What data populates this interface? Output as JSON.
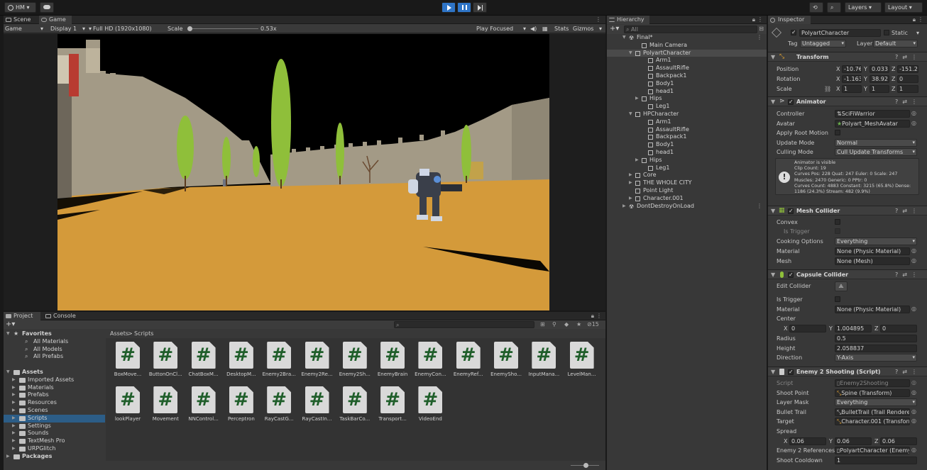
{
  "toolbar": {
    "account_label": "HM",
    "layers_label": "Layers",
    "layout_label": "Layout"
  },
  "game": {
    "tab_scene": "Scene",
    "tab_game": "Game",
    "mode": "Game",
    "display": "Display 1",
    "resolution": "Full HD (1920x1080)",
    "scale_label": "Scale",
    "scale_value": "0.53x",
    "play_focused": "Play Focused",
    "stats": "Stats",
    "gizmos": "Gizmos"
  },
  "hierarchy": {
    "tab": "Hierarchy",
    "search_placeholder": "All",
    "rows": [
      {
        "label": "Final*",
        "indent": 0,
        "arrow": "▼",
        "kind": "scene"
      },
      {
        "label": "Main Camera",
        "indent": 2,
        "arrow": "",
        "kind": "obj"
      },
      {
        "label": "PolyartCharacter",
        "indent": 1,
        "arrow": "▼",
        "kind": "obj",
        "sel": true
      },
      {
        "label": "Arm1",
        "indent": 3,
        "arrow": "",
        "kind": "obj"
      },
      {
        "label": "AssaultRifle",
        "indent": 3,
        "arrow": "",
        "kind": "obj"
      },
      {
        "label": "Backpack1",
        "indent": 3,
        "arrow": "",
        "kind": "obj"
      },
      {
        "label": "Body1",
        "indent": 3,
        "arrow": "",
        "kind": "obj"
      },
      {
        "label": "head1",
        "indent": 3,
        "arrow": "",
        "kind": "obj"
      },
      {
        "label": "Hips",
        "indent": 2,
        "arrow": "▶",
        "kind": "obj"
      },
      {
        "label": "Leg1",
        "indent": 3,
        "arrow": "",
        "kind": "obj"
      },
      {
        "label": "HPCharacter",
        "indent": 1,
        "arrow": "▼",
        "kind": "obj"
      },
      {
        "label": "Arm1",
        "indent": 3,
        "arrow": "",
        "kind": "obj"
      },
      {
        "label": "AssaultRifle",
        "indent": 3,
        "arrow": "",
        "kind": "obj"
      },
      {
        "label": "Backpack1",
        "indent": 3,
        "arrow": "",
        "kind": "obj"
      },
      {
        "label": "Body1",
        "indent": 3,
        "arrow": "",
        "kind": "obj"
      },
      {
        "label": "head1",
        "indent": 3,
        "arrow": "",
        "kind": "obj"
      },
      {
        "label": "Hips",
        "indent": 2,
        "arrow": "▶",
        "kind": "obj"
      },
      {
        "label": "Leg1",
        "indent": 3,
        "arrow": "",
        "kind": "obj"
      },
      {
        "label": "Core",
        "indent": 1,
        "arrow": "▶",
        "kind": "obj"
      },
      {
        "label": "THE WHOLE CITY",
        "indent": 1,
        "arrow": "▶",
        "kind": "obj"
      },
      {
        "label": "Point Light",
        "indent": 1,
        "arrow": "",
        "kind": "obj"
      },
      {
        "label": "Character.001",
        "indent": 1,
        "arrow": "▶",
        "kind": "obj"
      },
      {
        "label": "DontDestroyOnLoad",
        "indent": 0,
        "arrow": "▶",
        "kind": "scene"
      }
    ]
  },
  "inspector": {
    "tab": "Inspector",
    "object_name": "PolyartCharacter",
    "static_label": "Static",
    "tag_label": "Tag",
    "tag_value": "Untagged",
    "layer_label": "Layer",
    "layer_value": "Default",
    "transform": {
      "title": "Transform",
      "position_label": "Position",
      "position": [
        "-10.7€",
        "0.033",
        "-151.2"
      ],
      "rotation_label": "Rotation",
      "rotation": [
        "-1.163",
        "38.92",
        "0"
      ],
      "scale_label": "Scale",
      "scale": [
        "1",
        "1",
        "1"
      ]
    },
    "animator": {
      "title": "Animator",
      "controller_label": "Controller",
      "controller": "SciFiWarrior",
      "avatar_label": "Avatar",
      "avatar": "Polyart_MeshAvatar",
      "apply_root_motion": "Apply Root Motion",
      "update_mode_label": "Update Mode",
      "update_mode": "Normal",
      "culling_mode_label": "Culling Mode",
      "culling_mode": "Cull Update Transforms",
      "info_lines": [
        "Animator is visible",
        "Clip Count: 19",
        "Curves Pos: 228 Quat: 247 Euler: 0 Scale: 247",
        "Muscles: 2470 Generic: 0 PPtr: 0",
        "Curves Count: 4883 Constant: 3215 (65.8%) Dense:",
        "1186 (24.3%) Stream: 482 (9.9%)"
      ]
    },
    "mesh_collider": {
      "title": "Mesh Collider",
      "convex": "Convex",
      "is_trigger": "Is Trigger",
      "cooking_label": "Cooking Options",
      "cooking": "Everything",
      "material_label": "Material",
      "material": "None (Physic Material)",
      "mesh_label": "Mesh",
      "mesh": "None (Mesh)"
    },
    "capsule": {
      "title": "Capsule Collider",
      "edit_collider": "Edit Collider",
      "is_trigger": "Is Trigger",
      "material_label": "Material",
      "material": "None (Physic Material)",
      "center_label": "Center",
      "center": [
        "0",
        "1.004895",
        "0"
      ],
      "radius_label": "Radius",
      "radius": "0.5",
      "height_label": "Height",
      "height": "2.058837",
      "direction_label": "Direction",
      "direction": "Y-Axis"
    },
    "enemy": {
      "title": "Enemy 2 Shooting (Script)",
      "script_label": "Script",
      "script": "Enemy2Shooting",
      "shoot_point_label": "Shoot Point",
      "shoot_point": "Spine (Transform)",
      "layer_mask_label": "Layer Mask",
      "layer_mask": "Everything",
      "bullet_trail_label": "Bullet Trail",
      "bullet_trail": "BulletTrail (Trail Rendere",
      "target_label": "Target",
      "target": "Character.001 (Transform",
      "spread_label": "Spread",
      "spread": [
        "0.06",
        "0.06",
        "0.06"
      ],
      "refs_label": "Enemy 2 References",
      "refs": "PolyartCharacter (Enemy",
      "cooldown_label": "Shoot Cooldown",
      "cooldown": "1"
    }
  },
  "project": {
    "tab_project": "Project",
    "tab_console": "Console",
    "breadcrumb_root": "Assets",
    "breadcrumb_current": "Scripts",
    "hidden_count": "15",
    "tree": [
      {
        "label": "Favorites",
        "indent": 0,
        "kind": "star",
        "bold": true
      },
      {
        "label": "All Materials",
        "indent": 2,
        "kind": "search"
      },
      {
        "label": "All Models",
        "indent": 2,
        "kind": "search"
      },
      {
        "label": "All Prefabs",
        "indent": 2,
        "kind": "search"
      },
      {
        "label": "",
        "indent": 0,
        "kind": "gap"
      },
      {
        "label": "Assets",
        "indent": 0,
        "kind": "folder",
        "bold": true
      },
      {
        "label": "Imported Assets",
        "indent": 1,
        "kind": "folder"
      },
      {
        "label": "Materials",
        "indent": 1,
        "kind": "folder"
      },
      {
        "label": "Prefabs",
        "indent": 1,
        "kind": "folder"
      },
      {
        "label": "Resources",
        "indent": 1,
        "kind": "folder"
      },
      {
        "label": "Scenes",
        "indent": 1,
        "kind": "folder"
      },
      {
        "label": "Scripts",
        "indent": 1,
        "kind": "folder",
        "sel": true
      },
      {
        "label": "Settings",
        "indent": 1,
        "kind": "folder"
      },
      {
        "label": "Sounds",
        "indent": 1,
        "kind": "folder"
      },
      {
        "label": "TextMesh Pro",
        "indent": 1,
        "kind": "folder"
      },
      {
        "label": "URPGlitch",
        "indent": 1,
        "kind": "folder"
      },
      {
        "label": "Packages",
        "indent": 0,
        "kind": "folder",
        "bold": true
      }
    ],
    "scripts": [
      "BoxMove...",
      "ButtonOnCl...",
      "ChatBoxM...",
      "DesktopM...",
      "Enemy2Bra...",
      "Enemy2Re...",
      "Enemy2Sh...",
      "EnemyBrain",
      "EnemyCon...",
      "EnemyRef...",
      "EnemySho...",
      "InputMana...",
      "LevelMan...",
      "lookPlayer",
      "Movement",
      "NNControl...",
      "Perceptron",
      "RayCastG...",
      "RayCastIn...",
      "TaskBarCo...",
      "Transport...",
      "VideoEnd"
    ]
  },
  "colors": {
    "accent": "#2e74c6",
    "selection": "#2c5d87",
    "sky": "#000000",
    "ground": "#d49a3a",
    "wall": "#a39a86",
    "tree": "#8fbf3a",
    "script_hash": "#1f5e2a"
  }
}
